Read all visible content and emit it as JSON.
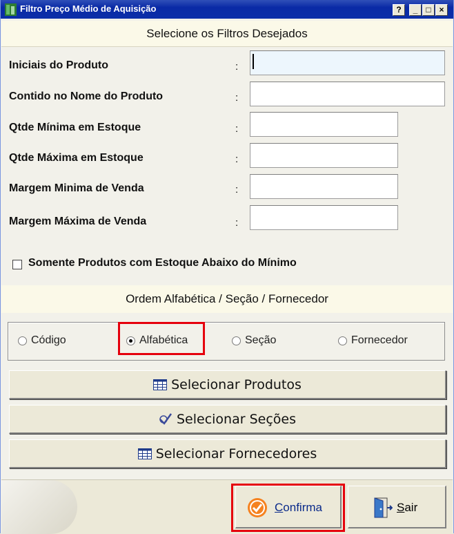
{
  "window": {
    "title": "Filtro Preço Médio de Aquisição",
    "controls": {
      "help": "?",
      "minimize": "_",
      "maximize": "□",
      "close": "×"
    }
  },
  "filters": {
    "heading": "Selecione os Filtros Desejados",
    "fields": [
      {
        "label": "Iniciais do Produto",
        "colon": ":",
        "value": ""
      },
      {
        "label": "Contido no Nome do Produto",
        "colon": ":",
        "value": ""
      },
      {
        "label": "Qtde Mínima em Estoque",
        "colon": ":",
        "value": ""
      },
      {
        "label": "Qtde Máxima em Estoque",
        "colon": ":",
        "value": ""
      },
      {
        "label": "Margem Minima de Venda",
        "colon": ":",
        "value": ""
      },
      {
        "label": "Margem Máxima de Venda",
        "colon": ":",
        "value": ""
      }
    ],
    "checkbox_label": "Somente Produtos com Estoque Abaixo do Mínimo",
    "checkbox_checked": false
  },
  "order": {
    "heading": "Ordem Alfabética / Seção / Fornecedor",
    "options": [
      {
        "label": "Código",
        "selected": false
      },
      {
        "label": "Alfabética",
        "selected": true
      },
      {
        "label": "Seção",
        "selected": false
      },
      {
        "label": "Fornecedor",
        "selected": false
      }
    ]
  },
  "actions": {
    "select_products": "Selecionar Produtos",
    "select_sections": "Selecionar Seções",
    "select_suppliers": "Selecionar Fornecedores"
  },
  "footer": {
    "confirm_accel": "C",
    "confirm_rest": "onfirma",
    "exit_accel": "S",
    "exit_rest": "air"
  },
  "colors": {
    "title_bar": "#0a2aa6",
    "highlight": "#e5000c",
    "link_text": "#0a2a8a"
  }
}
